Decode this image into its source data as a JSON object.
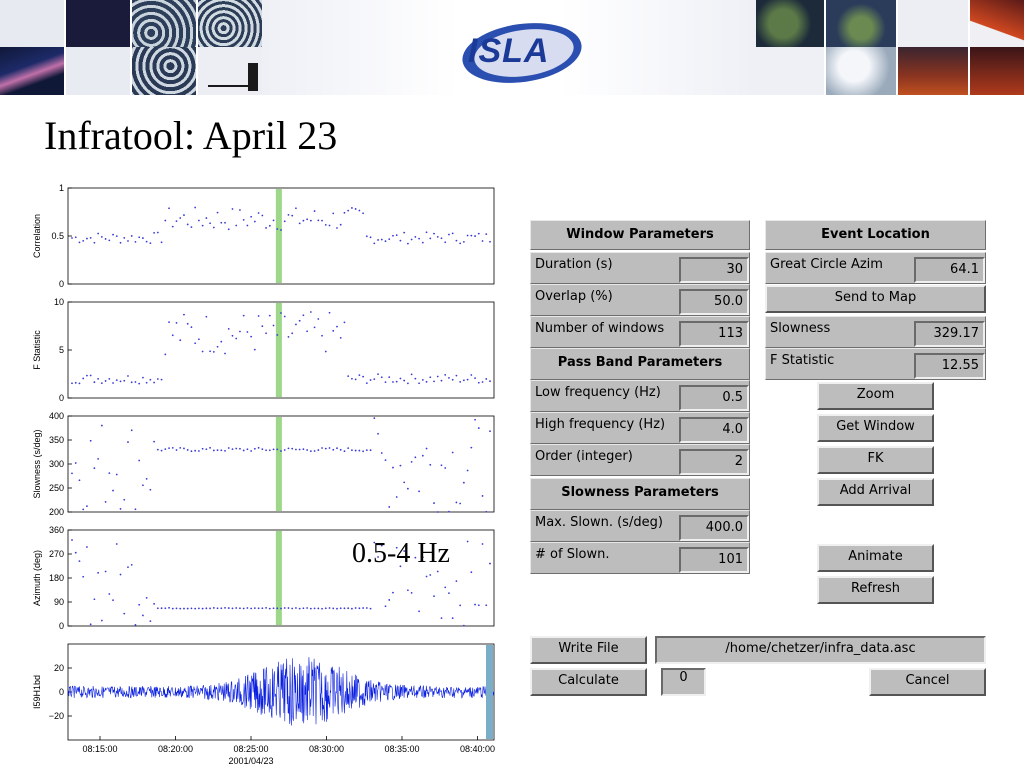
{
  "title": "Infratool: April 23",
  "logo_text": "ISLA",
  "freq_label": "0.5-4 Hz",
  "colors": {
    "dots": "#3a3ad8",
    "highlight": "#9ed68a",
    "waveform": "#0a1fe0",
    "end_marker": "#7aaec8",
    "gui_bg": "#bdbdbd"
  },
  "plots": {
    "correlation": {
      "ylabel": "Correlation",
      "yticks": [
        "0",
        "0.5",
        "1"
      ]
    },
    "fstat": {
      "ylabel": "F Statistic",
      "yticks": [
        "0",
        "5",
        "10"
      ]
    },
    "slowness": {
      "ylabel": "Slowness (s/deg)",
      "yticks": [
        "200",
        "250",
        "300",
        "350",
        "400"
      ]
    },
    "azimuth": {
      "ylabel": "Azimuth (deg)",
      "yticks": [
        "0",
        "90",
        "180",
        "270",
        "360"
      ]
    },
    "waveform": {
      "ylabel": "I59H1bd",
      "yticks": [
        "20",
        "0",
        "−20"
      ]
    },
    "xticks": [
      "08:15:00",
      "08:20:00",
      "08:25:00",
      "08:30:00",
      "08:35:00",
      "08:40:00"
    ],
    "xdate": "2001/04/23"
  },
  "window_params": {
    "header": "Window Parameters",
    "duration": {
      "label": "Duration (s)",
      "value": "30"
    },
    "overlap": {
      "label": "Overlap (%)",
      "value": "50.0"
    },
    "num_windows": {
      "label": "Number of windows",
      "value": "113"
    }
  },
  "pass_band": {
    "header": "Pass Band Parameters",
    "low": {
      "label": "Low frequency (Hz)",
      "value": "0.5"
    },
    "high": {
      "label": "High frequency (Hz)",
      "value": "4.0"
    },
    "order": {
      "label": "Order (integer)",
      "value": "2"
    }
  },
  "slowness_params": {
    "header": "Slowness Parameters",
    "max": {
      "label": "Max. Slown. (s/deg)",
      "value": "400.0"
    },
    "num": {
      "label": "# of Slown.",
      "value": "101"
    }
  },
  "event_location": {
    "header": "Event Location",
    "gc_azim": {
      "label": "Great Circle Azim",
      "value": "64.1"
    },
    "send_to_map": "Send to Map",
    "slowness": {
      "label": "Slowness",
      "value": "329.17"
    },
    "fstat": {
      "label": "F Statistic",
      "value": "12.55"
    }
  },
  "buttons": {
    "zoom": "Zoom",
    "get_window": "Get Window",
    "fk": "FK",
    "add_arrival": "Add Arrival",
    "animate": "Animate",
    "refresh": "Refresh",
    "write_file": "Write File",
    "calculate": "Calculate",
    "cancel": "Cancel"
  },
  "file_path": "/home/chetzer/infra_data.asc",
  "calc_value": "0"
}
